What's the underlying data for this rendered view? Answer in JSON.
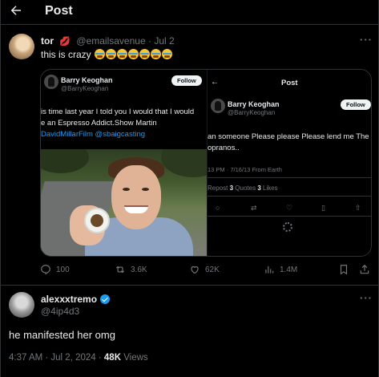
{
  "header": {
    "title": "Post",
    "back_icon": "arrow-left-icon"
  },
  "quoted_tweet": {
    "author_name": "tor",
    "author_emoji": "lips-icon",
    "handle": "@emailsavenue",
    "date": "Jul 2",
    "text": "this is crazy",
    "emojis": [
      "loudly-crying-face",
      "loudly-crying-face",
      "loudly-crying-face",
      "loudly-crying-face",
      "loudly-crying-face",
      "loudly-crying-face",
      "loudly-crying-face"
    ],
    "more_icon": "more-dots-icon"
  },
  "media": {
    "left": {
      "name": "Barry Keoghan",
      "handle": "@BarryKeoghan",
      "follow_label": "Follow",
      "line1": "is time last year I told you I would that I would",
      "line2": "e an Espresso Addict.Show Martin",
      "line3": "DavidMillarFilm @sbaigcasting"
    },
    "right": {
      "title": "Post",
      "name": "Barry Keoghan",
      "handle": "@BarryKeoghan",
      "follow_label": "Follow",
      "line1": "an someone Please please Please lend me The",
      "line2": "opranos..",
      "meta": "13 PM · 7/16/13 From Earth",
      "reposts_label": "Repost",
      "reposts": "3",
      "quotes_label": "Quotes",
      "quotes": "3",
      "likes_label": "Likes"
    }
  },
  "actions": {
    "replies": "100",
    "reposts": "3.6K",
    "likes": "62K",
    "views": "1.4M"
  },
  "reply_tweet": {
    "author_name": "alexxxtremo",
    "handle": "@4ip4d3",
    "text": "he manifested her omg",
    "time": "4:37 AM · Jul 2, 2024 ·",
    "views": "48K",
    "views_label": "Views"
  },
  "colors": {
    "accent": "#1d9bf0",
    "muted": "#71767b",
    "text": "#e7e9ea",
    "background": "#000000"
  }
}
